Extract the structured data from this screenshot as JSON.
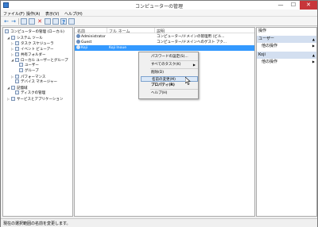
{
  "window": {
    "title": "コンピューターの管理",
    "min": "—",
    "max": "☐",
    "close": "✕"
  },
  "menu": [
    "ファイル(F)",
    "操作(A)",
    "表示(V)",
    "ヘルプ(H)"
  ],
  "toolbar": {
    "back": "←",
    "forward": "→",
    "delete": "✕",
    "help": "?"
  },
  "tree": [
    {
      "label": "コンピューターの管理 (ローカル)",
      "twisty": "",
      "icon": "computer-management-icon"
    },
    {
      "label": "システム ツール",
      "twisty": "◢",
      "icon": "tools-icon"
    },
    {
      "label": "タスク スケジューラ",
      "twisty": "▷",
      "icon": "clock-icon"
    },
    {
      "label": "イベント ビューアー",
      "twisty": "▷",
      "icon": "event-viewer-icon"
    },
    {
      "label": "共有フォルダー",
      "twisty": "▷",
      "icon": "shared-folder-icon"
    },
    {
      "label": "ローカル ユーザーとグループ",
      "twisty": "◢",
      "icon": "users-icon"
    },
    {
      "label": "ユーザー",
      "twisty": "",
      "icon": "folder-icon"
    },
    {
      "label": "グループ",
      "twisty": "",
      "icon": "folder-icon"
    },
    {
      "label": "パフォーマンス",
      "twisty": "▷",
      "icon": "performance-icon"
    },
    {
      "label": "デバイス マネージャー",
      "twisty": "",
      "icon": "device-manager-icon"
    },
    {
      "label": "記憶域",
      "twisty": "◢",
      "icon": "storage-icon"
    },
    {
      "label": "ディスクの管理",
      "twisty": "",
      "icon": "disk-icon"
    },
    {
      "label": "サービスとアプリケーション",
      "twisty": "▷",
      "icon": "services-icon"
    }
  ],
  "columns": {
    "name": "名前",
    "fullname": "フル ネーム",
    "description": "説明"
  },
  "users": [
    {
      "name": "Administrator",
      "fullname": "",
      "description": "コンピューター/ドメインの管理用 (ビル..."
    },
    {
      "name": "Guest",
      "fullname": "",
      "description": "コンピューター/ドメインへのゲスト アク..."
    },
    {
      "name": "Koji",
      "fullname": "Koji Inoue",
      "description": ""
    }
  ],
  "context_menu": {
    "set_password": "パスワードの設定(S)...",
    "all_tasks": "すべてのタスク(K)",
    "delete": "削除(D)",
    "rename": "名前の変更(M)",
    "properties": "プロパティ(R)",
    "help": "ヘルプ(H)",
    "submenu_arrow": "▶"
  },
  "actions": {
    "header": "操作",
    "section1": "ユーザー",
    "section1_item": "他の操作",
    "section2": "Koji",
    "section2_item": "他の操作",
    "section_arrow": "▲",
    "item_arrow": "▶"
  },
  "status": "現在の選択範囲の名前を変更します。"
}
